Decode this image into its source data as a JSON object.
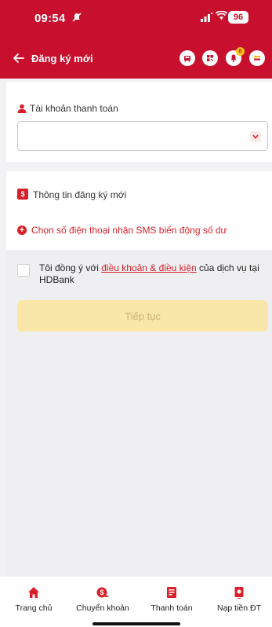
{
  "status_bar": {
    "time": "09:54",
    "signal": "❘❘❘",
    "wifi_icon": "wifi-icon",
    "battery": "96"
  },
  "header": {
    "title": "Đăng ký mới",
    "notification_count": "0",
    "accent_color": "#c8102e"
  },
  "account_section": {
    "title": "Tài khoản thanh toán",
    "selected_value": ""
  },
  "register_section": {
    "title": "Thông tin đăng ký mới",
    "sms_link": "Chọn số điện thoại nhận SMS biến động số dư"
  },
  "agreement": {
    "prefix": "Tôi đồng ý với ",
    "link": "điều khoản & điều kiện",
    "suffix": " của dịch vụ tại HDBank"
  },
  "continue_button": "Tiếp tục",
  "bottom_nav": [
    {
      "label": "Trang chủ",
      "icon": "home-icon"
    },
    {
      "label": "Chuyển khoản",
      "icon": "transfer-icon"
    },
    {
      "label": "Thanh toán",
      "icon": "bill-icon"
    },
    {
      "label": "Nạp tiền ĐT",
      "icon": "phone-topup-icon"
    }
  ]
}
